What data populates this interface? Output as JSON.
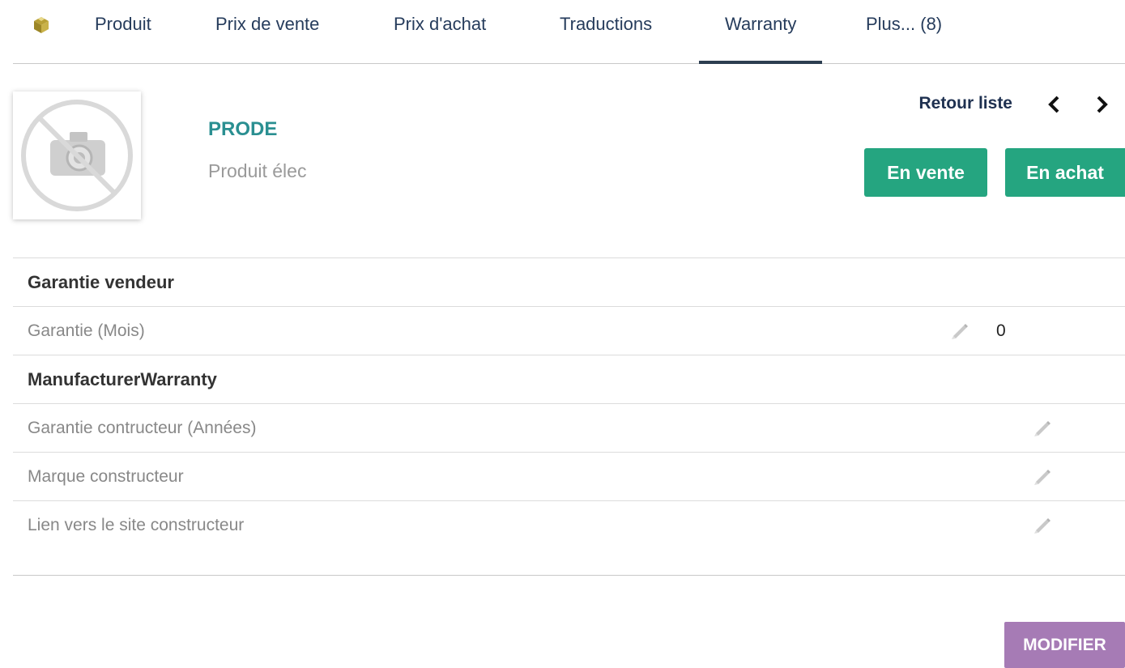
{
  "tabs": {
    "items": [
      {
        "label": "Produit"
      },
      {
        "label": "Prix de vente"
      },
      {
        "label": "Prix d'achat"
      },
      {
        "label": "Traductions"
      },
      {
        "label": "Warranty"
      },
      {
        "label": "Plus... (8)"
      }
    ],
    "active": "Warranty"
  },
  "product": {
    "ref": "PRODE",
    "label": "Produit élec"
  },
  "nav": {
    "back_label": "Retour liste",
    "status_sell": "En vente",
    "status_buy": "En achat"
  },
  "sections": {
    "vendor": {
      "title": "Garantie vendeur",
      "fields": [
        {
          "label": "Garantie (Mois)",
          "value": "0"
        }
      ]
    },
    "manufacturer": {
      "title": "ManufacturerWarranty",
      "fields": [
        {
          "label": "Garantie contructeur (Années)",
          "value": ""
        },
        {
          "label": "Marque constructeur",
          "value": ""
        },
        {
          "label": "Lien vers le site constructeur",
          "value": ""
        }
      ]
    }
  },
  "actions": {
    "modify_label": "MODIFIER"
  },
  "colors": {
    "status_green": "#25a580",
    "modify_purple": "#a67bb5",
    "ref_teal": "#2a8f91"
  }
}
